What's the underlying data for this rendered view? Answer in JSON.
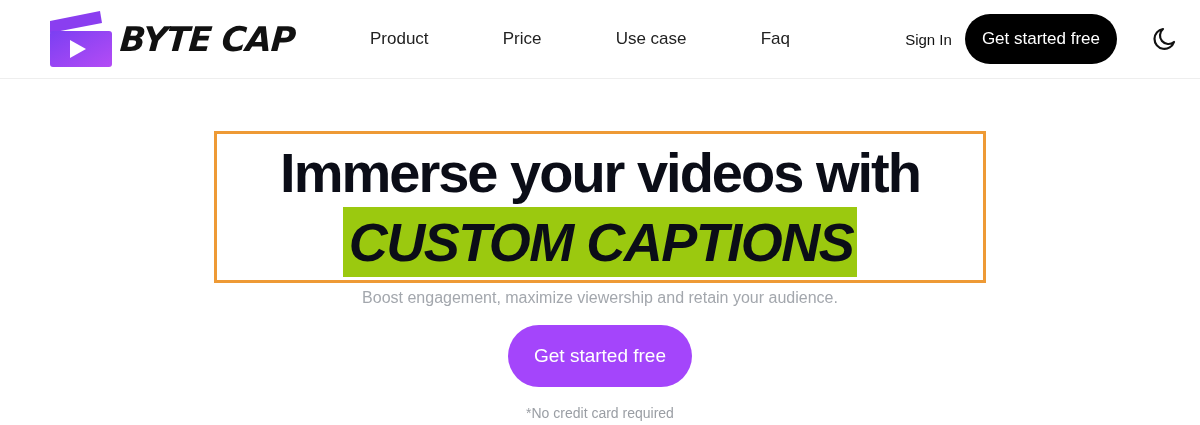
{
  "header": {
    "brand": "BYTE CAP",
    "nav": [
      {
        "label": "Product"
      },
      {
        "label": "Price"
      },
      {
        "label": "Use case"
      },
      {
        "label": "Faq"
      }
    ],
    "sign_in": "Sign In",
    "cta": "Get started free"
  },
  "hero": {
    "headline": "Immerse your videos with",
    "highlight": "CUSTOM CAPTIONS",
    "subtitle": "Boost engagement, maximize viewership and retain your audience.",
    "cta": "Get started free",
    "note": "*No credit card required"
  }
}
